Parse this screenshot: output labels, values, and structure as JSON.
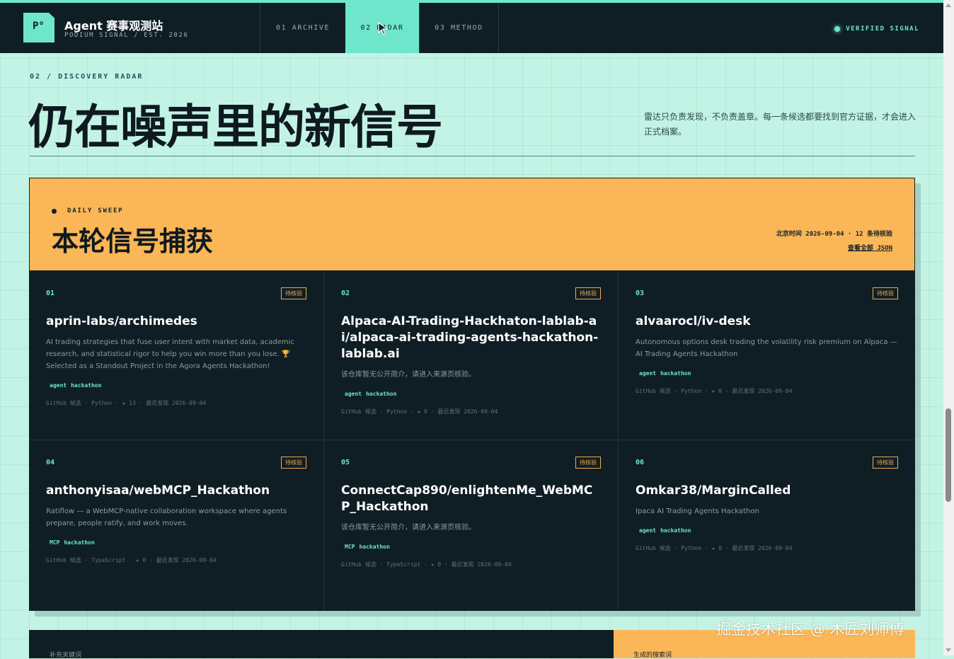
{
  "brand": {
    "logo": "P°",
    "title": "Agent 赛事观测站",
    "subtitle": "PODIUM SIGNAL / EST. 2026"
  },
  "nav": {
    "tabs": [
      {
        "label": "01  ARCHIVE",
        "active": false
      },
      {
        "label": "02  RADAR",
        "active": true
      },
      {
        "label": "03  METHOD",
        "active": false
      }
    ],
    "status": "VERIFIED SIGNAL"
  },
  "hero": {
    "breadcrumb": "02 / DISCOVERY RADAR",
    "title": "仍在噪声里的新信号",
    "description": "雷达只负责发现，不负责盖章。每一条候选都要找到官方证据，才会进入正式档案。"
  },
  "sweep": {
    "label": "DAILY SWEEP",
    "title": "本轮信号捕获",
    "meta": "北京时间 2026-09-04 · 12 条待核验",
    "link": "查看全部 JSON"
  },
  "cards": [
    {
      "num": "01",
      "badge": "待核验",
      "title": "aprin-labs/archimedes",
      "desc": "AI trading strategies that fuse user intent with market data, academic research, and statistical rigor to help you win more than you lose. 🏆 Selected as a Standout Project in the Agora Agents Hackathon!",
      "tags": [
        "agent",
        "hackathon"
      ],
      "meta": "GitHub 候选 · Python · ★ 13 · 最近发现 2026-09-04"
    },
    {
      "num": "02",
      "badge": "待核验",
      "title": "Alpaca-AI-Trading-Hackhaton-lablab-ai/alpaca-ai-trading-agents-hackathon-lablab.ai",
      "desc": "该仓库暂无公开简介，请进入来源页核验。",
      "tags": [
        "agent",
        "hackathon"
      ],
      "meta": "GitHub 候选 · Python · ★ 0 · 最近发现 2026-09-04"
    },
    {
      "num": "03",
      "badge": "待核验",
      "title": "alvaarocl/iv-desk",
      "desc": "Autonomous options desk trading the volatility risk premium on Alpaca — AI Trading Agents Hackathon",
      "tags": [
        "agent",
        "hackathon"
      ],
      "meta": "GitHub 候选 · Python · ★ 0 · 最近发现 2026-09-04"
    },
    {
      "num": "04",
      "badge": "待核验",
      "title": "anthonyisaa/webMCP_Hackathon",
      "desc": "Ratiflow — a WebMCP-native collaboration workspace where agents prepare, people ratify, and work moves.",
      "tags": [
        "MCP",
        "hackathon"
      ],
      "meta": "GitHub 候选 · TypeScript · ★ 0 · 最近发现 2026-09-04"
    },
    {
      "num": "05",
      "badge": "待核验",
      "title": "ConnectCap890/enlightenMe_WebMCP_Hackathon",
      "desc": "该仓库暂无公开简介，请进入来源页核验。",
      "tags": [
        "MCP",
        "hackathon"
      ],
      "meta": "GitHub 候选 · TypeScript · ★ 0 · 最近发现 2026-09-04"
    },
    {
      "num": "06",
      "badge": "待核验",
      "title": "Omkar38/MarginCalled",
      "desc": "Ipaca AI Trading Agents Hackathon",
      "tags": [
        "agent",
        "hackathon"
      ],
      "meta": "GitHub 候选 · Python · ★ 0 · 最近发现 2026-09-04"
    }
  ],
  "bottom": {
    "left_label": "补充关键词",
    "right_label": "生成的搜索词"
  },
  "watermark": "掘金技术社区 @ 木匠刘师傅",
  "colors": {
    "mint": "#6ee6cc",
    "navy": "#0f1e25",
    "orange": "#fbb657",
    "background": "#c3f3e4"
  }
}
